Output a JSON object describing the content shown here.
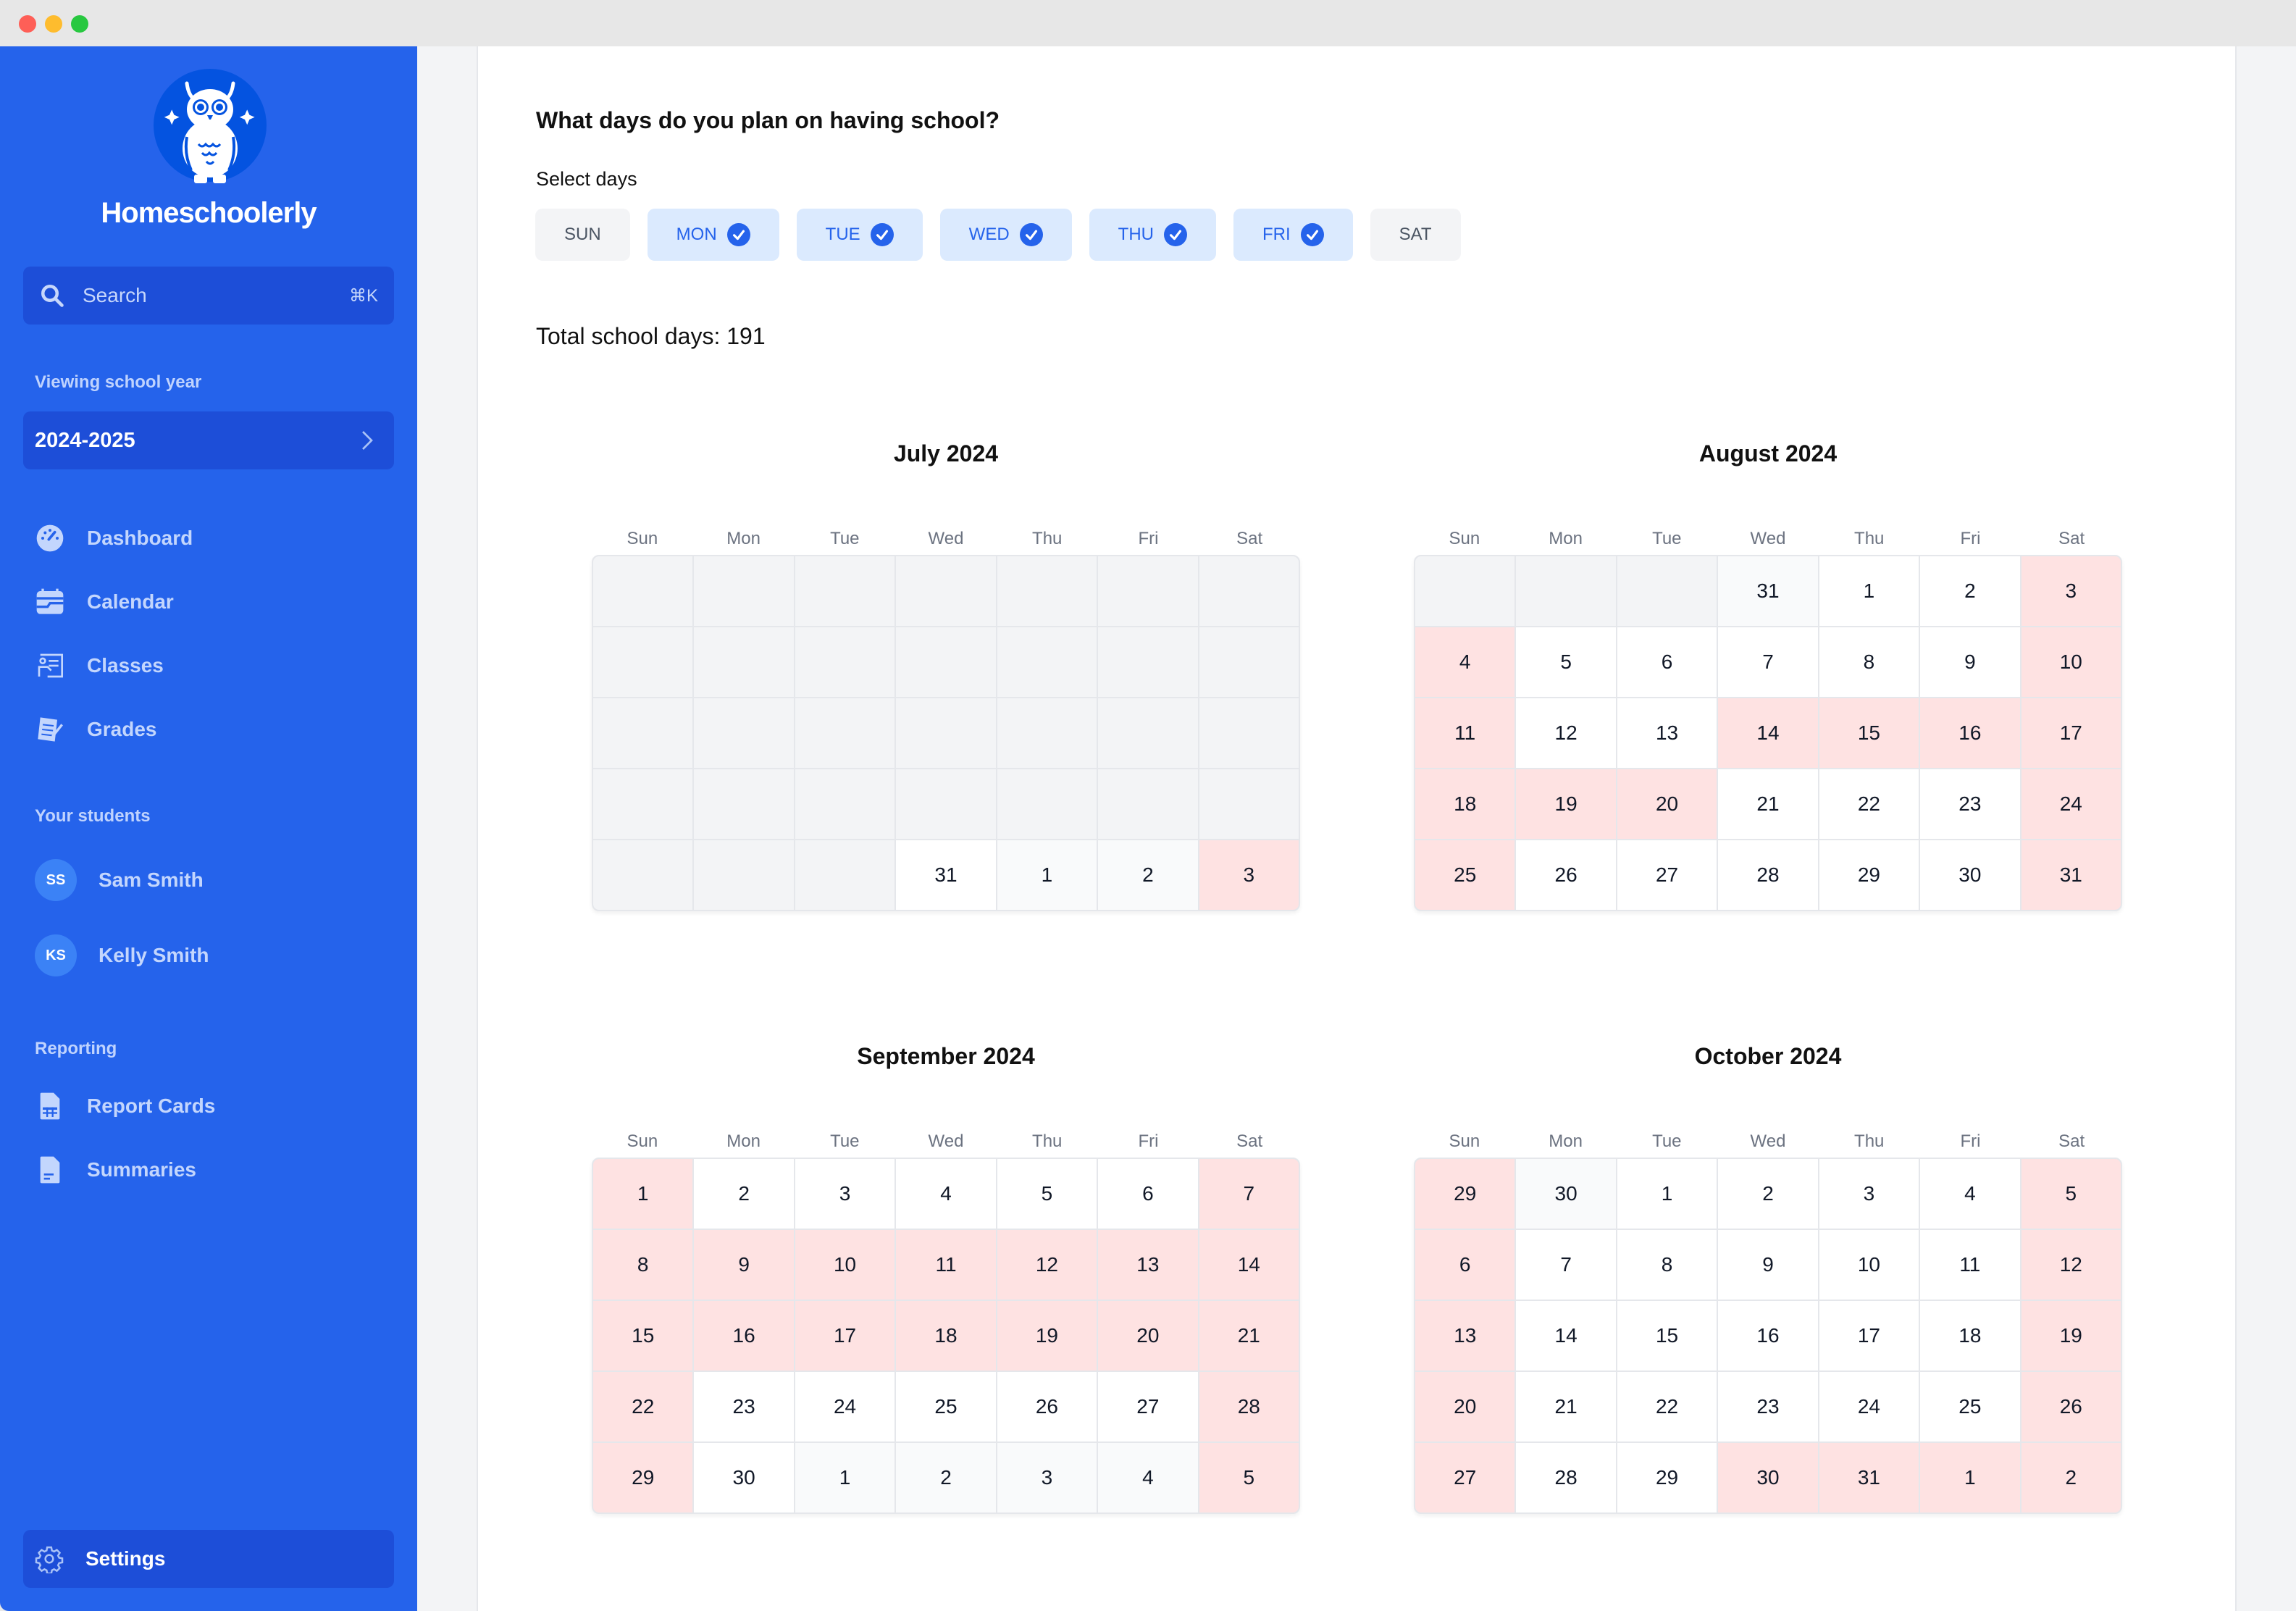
{
  "window": {
    "traffic_lights": [
      "close",
      "minimize",
      "zoom"
    ]
  },
  "sidebar": {
    "brand": "Homeschoolerly",
    "search": {
      "placeholder": "Search",
      "shortcut": "⌘K",
      "icon": "search-icon"
    },
    "school_year_label": "Viewing school year",
    "school_year_value": "2024-2025",
    "nav": [
      {
        "label": "Dashboard",
        "icon": "dashboard-gauge-icon"
      },
      {
        "label": "Calendar",
        "icon": "calendar-icon"
      },
      {
        "label": "Classes",
        "icon": "classes-icon"
      },
      {
        "label": "Grades",
        "icon": "grades-icon"
      }
    ],
    "students_label": "Your students",
    "students": [
      {
        "initials": "SS",
        "name": "Sam Smith"
      },
      {
        "initials": "KS",
        "name": "Kelly Smith"
      }
    ],
    "reporting_label": "Reporting",
    "reporting": [
      {
        "label": "Report Cards",
        "icon": "report-card-icon"
      },
      {
        "label": "Summaries",
        "icon": "summary-document-icon"
      }
    ],
    "settings_label": "Settings",
    "colors": {
      "sidebar_bg": "#2563eb",
      "item_bg": "#1d4ed8"
    }
  },
  "main": {
    "question": "What days do you plan on having school?",
    "select_days_label": "Select days",
    "days": [
      {
        "label": "SUN",
        "selected": false
      },
      {
        "label": "MON",
        "selected": true
      },
      {
        "label": "TUE",
        "selected": true
      },
      {
        "label": "WED",
        "selected": true
      },
      {
        "label": "THU",
        "selected": true
      },
      {
        "label": "FRI",
        "selected": true
      },
      {
        "label": "SAT",
        "selected": false
      }
    ],
    "total_school_days": "Total school days: 191",
    "weekday_headers": [
      "Sun",
      "Mon",
      "Tue",
      "Wed",
      "Thu",
      "Fri",
      "Sat"
    ],
    "legend_colors": {
      "off": "#fee2e2",
      "school": "#ffffff",
      "outside_month": "#f9fafb",
      "empty": "#f3f4f6"
    },
    "months": [
      {
        "title": "July 2024",
        "cells": [
          [
            "",
            "empty"
          ],
          [
            "",
            "empty"
          ],
          [
            "",
            "empty"
          ],
          [
            "",
            "empty"
          ],
          [
            "",
            "empty"
          ],
          [
            "",
            "empty"
          ],
          [
            "",
            "empty"
          ],
          [
            "",
            "empty"
          ],
          [
            "",
            "empty"
          ],
          [
            "",
            "empty"
          ],
          [
            "",
            "empty"
          ],
          [
            "",
            "empty"
          ],
          [
            "",
            "empty"
          ],
          [
            "",
            "empty"
          ],
          [
            "",
            "empty"
          ],
          [
            "",
            "empty"
          ],
          [
            "",
            "empty"
          ],
          [
            "",
            "empty"
          ],
          [
            "",
            "empty"
          ],
          [
            "",
            "empty"
          ],
          [
            "",
            "empty"
          ],
          [
            "",
            "empty"
          ],
          [
            "",
            "empty"
          ],
          [
            "",
            "empty"
          ],
          [
            "",
            "empty"
          ],
          [
            "",
            "empty"
          ],
          [
            "",
            "empty"
          ],
          [
            "",
            "empty"
          ],
          [
            "",
            "empty"
          ],
          [
            "",
            "empty"
          ],
          [
            "",
            "empty"
          ],
          [
            "31",
            "school"
          ],
          [
            "1",
            "other"
          ],
          [
            "2",
            "other"
          ],
          [
            "3",
            "off"
          ]
        ]
      },
      {
        "title": "August 2024",
        "cells": [
          [
            "",
            "empty"
          ],
          [
            "",
            "empty"
          ],
          [
            "",
            "empty"
          ],
          [
            "31",
            "other"
          ],
          [
            "1",
            "school"
          ],
          [
            "2",
            "school"
          ],
          [
            "3",
            "off"
          ],
          [
            "4",
            "off"
          ],
          [
            "5",
            "school"
          ],
          [
            "6",
            "school"
          ],
          [
            "7",
            "school"
          ],
          [
            "8",
            "school"
          ],
          [
            "9",
            "school"
          ],
          [
            "10",
            "off"
          ],
          [
            "11",
            "off"
          ],
          [
            "12",
            "school"
          ],
          [
            "13",
            "school"
          ],
          [
            "14",
            "off"
          ],
          [
            "15",
            "off"
          ],
          [
            "16",
            "off"
          ],
          [
            "17",
            "off"
          ],
          [
            "18",
            "off"
          ],
          [
            "19",
            "off"
          ],
          [
            "20",
            "off"
          ],
          [
            "21",
            "school"
          ],
          [
            "22",
            "school"
          ],
          [
            "23",
            "school"
          ],
          [
            "24",
            "off"
          ],
          [
            "25",
            "off"
          ],
          [
            "26",
            "school"
          ],
          [
            "27",
            "school"
          ],
          [
            "28",
            "school"
          ],
          [
            "29",
            "school"
          ],
          [
            "30",
            "school"
          ],
          [
            "31",
            "off"
          ]
        ]
      },
      {
        "title": "September 2024",
        "cells": [
          [
            "1",
            "off"
          ],
          [
            "2",
            "school"
          ],
          [
            "3",
            "school"
          ],
          [
            "4",
            "school"
          ],
          [
            "5",
            "school"
          ],
          [
            "6",
            "school"
          ],
          [
            "7",
            "off"
          ],
          [
            "8",
            "off"
          ],
          [
            "9",
            "off"
          ],
          [
            "10",
            "off"
          ],
          [
            "11",
            "off"
          ],
          [
            "12",
            "off"
          ],
          [
            "13",
            "off"
          ],
          [
            "14",
            "off"
          ],
          [
            "15",
            "off"
          ],
          [
            "16",
            "off"
          ],
          [
            "17",
            "off"
          ],
          [
            "18",
            "off"
          ],
          [
            "19",
            "off"
          ],
          [
            "20",
            "off"
          ],
          [
            "21",
            "off"
          ],
          [
            "22",
            "off"
          ],
          [
            "23",
            "school"
          ],
          [
            "24",
            "school"
          ],
          [
            "25",
            "school"
          ],
          [
            "26",
            "school"
          ],
          [
            "27",
            "school"
          ],
          [
            "28",
            "off"
          ],
          [
            "29",
            "off"
          ],
          [
            "30",
            "school"
          ],
          [
            "1",
            "other"
          ],
          [
            "2",
            "other"
          ],
          [
            "3",
            "other"
          ],
          [
            "4",
            "other"
          ],
          [
            "5",
            "off"
          ]
        ]
      },
      {
        "title": "October 2024",
        "cells": [
          [
            "29",
            "off"
          ],
          [
            "30",
            "other"
          ],
          [
            "1",
            "school"
          ],
          [
            "2",
            "school"
          ],
          [
            "3",
            "school"
          ],
          [
            "4",
            "school"
          ],
          [
            "5",
            "off"
          ],
          [
            "6",
            "off"
          ],
          [
            "7",
            "school"
          ],
          [
            "8",
            "school"
          ],
          [
            "9",
            "school"
          ],
          [
            "10",
            "school"
          ],
          [
            "11",
            "school"
          ],
          [
            "12",
            "off"
          ],
          [
            "13",
            "off"
          ],
          [
            "14",
            "school"
          ],
          [
            "15",
            "school"
          ],
          [
            "16",
            "school"
          ],
          [
            "17",
            "school"
          ],
          [
            "18",
            "school"
          ],
          [
            "19",
            "off"
          ],
          [
            "20",
            "off"
          ],
          [
            "21",
            "school"
          ],
          [
            "22",
            "school"
          ],
          [
            "23",
            "school"
          ],
          [
            "24",
            "school"
          ],
          [
            "25",
            "school"
          ],
          [
            "26",
            "off"
          ],
          [
            "27",
            "off"
          ],
          [
            "28",
            "school"
          ],
          [
            "29",
            "school"
          ],
          [
            "30",
            "off"
          ],
          [
            "31",
            "off"
          ],
          [
            "1",
            "off"
          ],
          [
            "2",
            "off"
          ]
        ]
      }
    ]
  }
}
